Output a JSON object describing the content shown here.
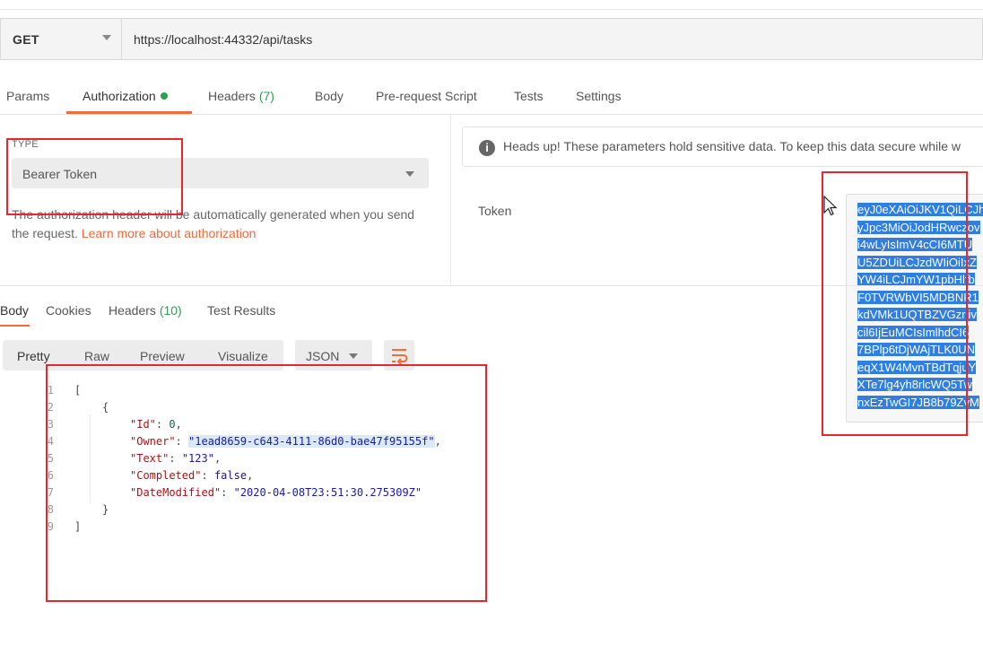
{
  "request": {
    "method": "GET",
    "url": "https://localhost:44332/api/tasks"
  },
  "request_tabs": [
    {
      "label": "Params"
    },
    {
      "label": "Authorization"
    },
    {
      "label": "Headers",
      "count": "(7)"
    },
    {
      "label": "Body"
    },
    {
      "label": "Pre-request Script"
    },
    {
      "label": "Tests"
    },
    {
      "label": "Settings"
    }
  ],
  "auth": {
    "type_label": "TYPE",
    "type_value": "Bearer Token",
    "desc_text": "The authorization header will be automatically generated when you send the request.",
    "desc_link": "Learn more about authorization",
    "notice_icon": "i",
    "notice_text": "Heads up! These parameters hold sensitive data. To keep this data secure while w",
    "token_label": "Token",
    "token_lines": [
      "eyJ0eXAiOiJKV1QiLCJh",
      "yJpc3MiOiJodHRwczov",
      "i4wLyIsImV4cCI6MTU",
      "U5ZDUiLCJzdWIiOiIxZ",
      "YW4iLCJmYW1pbHlfb",
      "F0TVRWbVI5MDBNR1",
      "kdVMk1UQTBZVGzrliv",
      "cil6IjEuMCIsImlhdCI6",
      "7BPlp6tDjWAjTLK0UN",
      "eqX1W4MvnTBdTqjuY",
      "XTe7lg4yh8rlcWQ5Tw",
      "nxEzTwGI7JB8b79ZvM"
    ]
  },
  "response_tabs": [
    {
      "label": "Body"
    },
    {
      "label": "Cookies"
    },
    {
      "label": "Headers",
      "count": "(10)"
    },
    {
      "label": "Test Results"
    }
  ],
  "view_modes": [
    "Pretty",
    "Raw",
    "Preview",
    "Visualize"
  ],
  "format": "JSON",
  "code": {
    "line_numbers": [
      "1",
      "2",
      "3",
      "4",
      "5",
      "6",
      "7",
      "8",
      "9"
    ],
    "open_bracket": "[",
    "open_brace": "{",
    "id_key": "\"Id\"",
    "id_value": "0",
    "owner_key": "\"Owner\"",
    "owner_value": "\"1ead8659-c643-4111-86d0-bae47f95155f\"",
    "text_key": "\"Text\"",
    "text_value": "\"123\"",
    "completed_key": "\"Completed\"",
    "completed_value": "false",
    "date_key": "\"DateModified\"",
    "date_value": "\"2020-04-08T23:51:30.275309Z\"",
    "close_brace": "}",
    "close_bracket": "]"
  },
  "colors": {
    "accent": "#f26b3a",
    "success": "#2e9e4f",
    "annotation_red": "#e8262d",
    "selection_blue": "#2f7ee0"
  }
}
